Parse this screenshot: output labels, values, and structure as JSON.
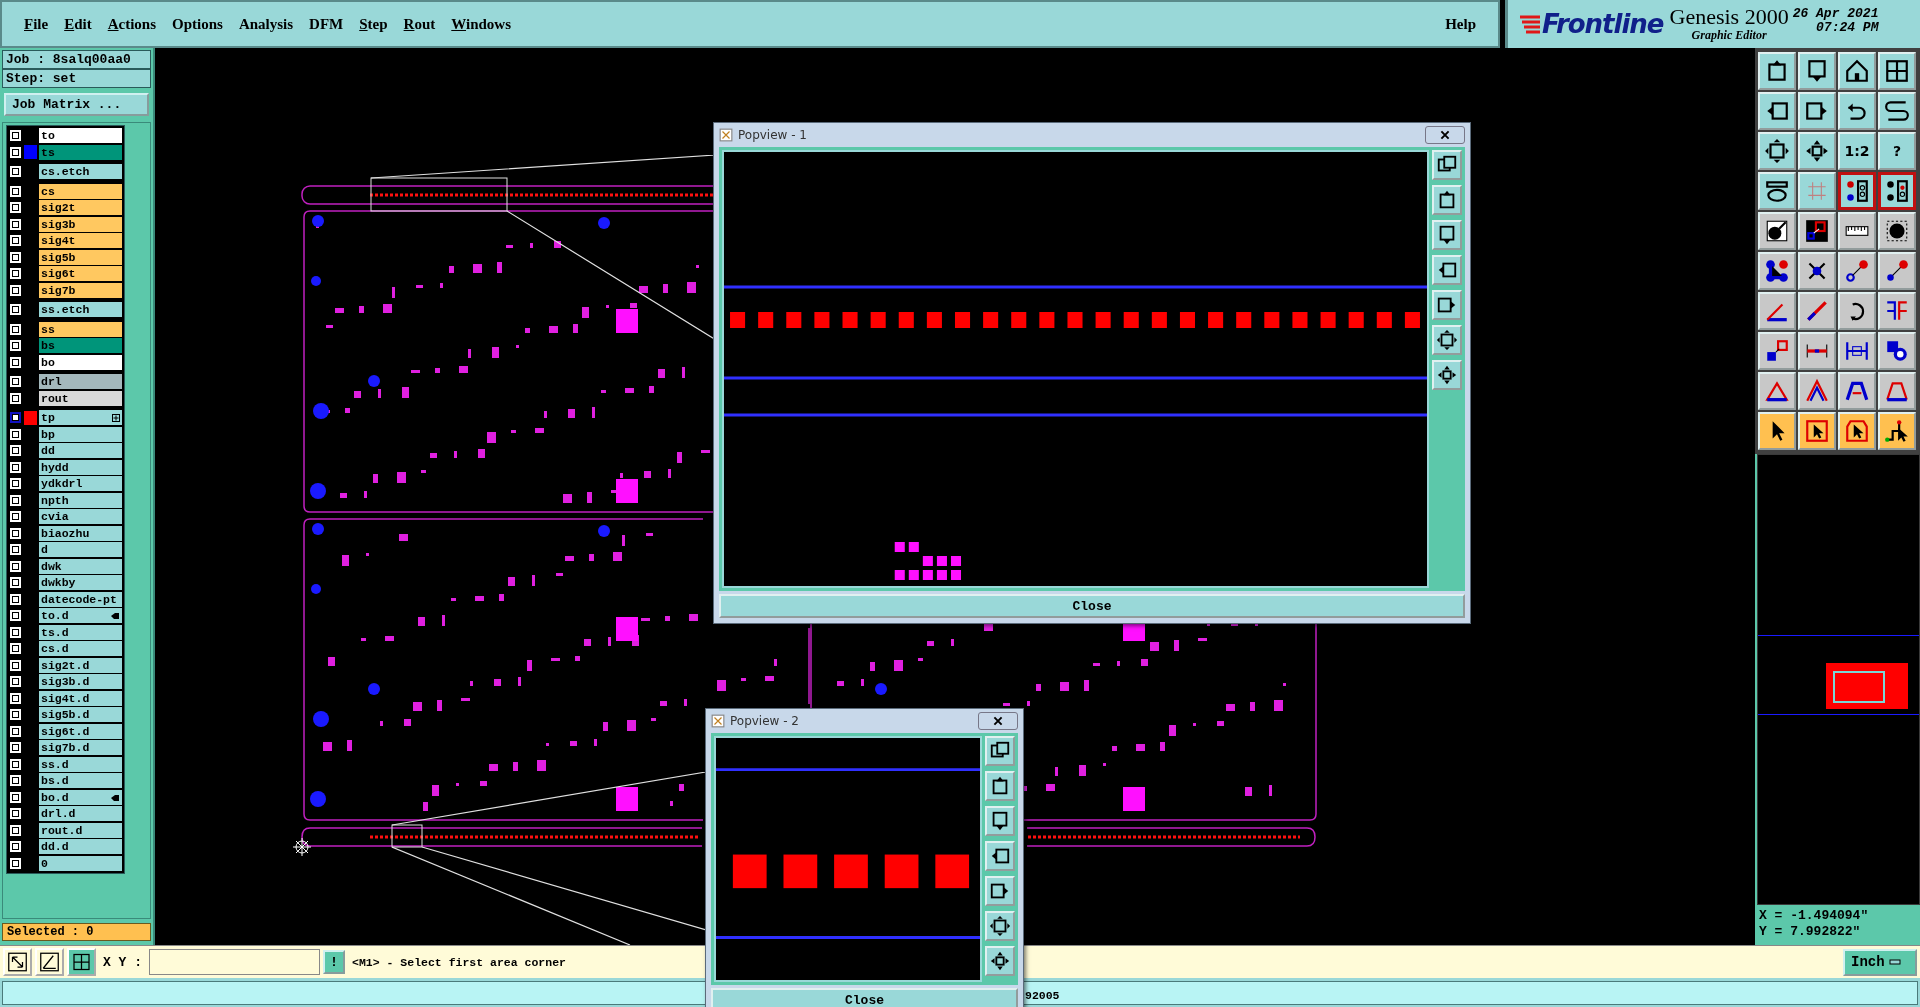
{
  "menu": [
    {
      "label": "File",
      "underlined": true
    },
    {
      "label": "Edit",
      "underlined": true
    },
    {
      "label": "Actions",
      "underlined": true
    },
    {
      "label": "Options",
      "underlined": false
    },
    {
      "label": "Analysis",
      "underlined": false
    },
    {
      "label": "DFM",
      "underlined": false
    },
    {
      "label": "Step",
      "underlined": true
    },
    {
      "label": "Rout",
      "underlined": true
    },
    {
      "label": "Windows",
      "underlined": true
    }
  ],
  "help": "Help",
  "brand": {
    "logo": "Frontline",
    "product": "Genesis 2000",
    "subtitle": "Graphic Editor",
    "date": "26 Apr 2021",
    "time": "07:24 PM"
  },
  "job": {
    "job": "Job : 8salq00aa0",
    "step": "Step: set",
    "matrix_button": "Job Matrix ..."
  },
  "layer_groups": [
    {
      "layers": [
        {
          "name": "to",
          "color": "#ffffff",
          "selected": false,
          "linked": false
        },
        {
          "name": "ts",
          "color": "#00957a",
          "swatch": {
            "color": "#0000ff"
          },
          "selected": false,
          "linked": false
        }
      ]
    },
    {
      "layers": [
        {
          "name": "cs.etch",
          "color": "#99d8d8",
          "selected": false,
          "linked": false
        }
      ]
    },
    {
      "layers": [
        {
          "name": "cs",
          "color": "#ffc860",
          "selected": false,
          "linked": false
        },
        {
          "name": "sig2t",
          "color": "#ffc860",
          "selected": false,
          "linked": false
        },
        {
          "name": "sig3b",
          "color": "#ffc860",
          "selected": false,
          "linked": false
        },
        {
          "name": "sig4t",
          "color": "#ffc860",
          "selected": false,
          "linked": false
        },
        {
          "name": "sig5b",
          "color": "#ffc860",
          "selected": false,
          "linked": false
        },
        {
          "name": "sig6t",
          "color": "#ffc860",
          "selected": false,
          "linked": false
        },
        {
          "name": "sig7b",
          "color": "#ffc860",
          "selected": false,
          "linked": false
        }
      ]
    },
    {
      "layers": [
        {
          "name": "ss.etch",
          "color": "#99d8d8",
          "selected": false,
          "linked": false
        }
      ]
    },
    {
      "layers": [
        {
          "name": "ss",
          "color": "#ffc860",
          "selected": false,
          "linked": false
        },
        {
          "name": "bs",
          "color": "#00957a",
          "selected": false,
          "linked": false
        },
        {
          "name": "bo",
          "color": "#ffffff",
          "selected": false,
          "linked": false
        }
      ]
    },
    {
      "layers": [
        {
          "name": "drl",
          "color": "#a4b8bc",
          "selected": false,
          "linked": false
        },
        {
          "name": "rout",
          "color": "#d8d8d8",
          "selected": false,
          "linked": false
        }
      ]
    },
    {
      "layers": [
        {
          "name": "tp",
          "color": "#99d8d8",
          "swatch": {
            "color": "#ff0000"
          },
          "selected": true,
          "linked": false
        },
        {
          "name": "bp",
          "color": "#99d8d8",
          "selected": false,
          "linked": false
        },
        {
          "name": "dd",
          "color": "#99d8d8",
          "selected": false,
          "linked": false
        },
        {
          "name": "hydd",
          "color": "#99d8d8",
          "selected": false,
          "linked": false
        },
        {
          "name": "ydkdrl",
          "color": "#99d8d8",
          "selected": false,
          "linked": false
        },
        {
          "name": "npth",
          "color": "#99d8d8",
          "selected": false,
          "linked": false
        },
        {
          "name": "cvia",
          "color": "#99d8d8",
          "selected": false,
          "linked": false
        },
        {
          "name": "biaozhu",
          "color": "#99d8d8",
          "selected": false,
          "linked": false
        },
        {
          "name": "d",
          "color": "#99d8d8",
          "selected": false,
          "linked": false
        },
        {
          "name": "dwk",
          "color": "#99d8d8",
          "selected": false,
          "linked": false
        },
        {
          "name": "dwkby",
          "color": "#99d8d8",
          "selected": false,
          "linked": false
        },
        {
          "name": "datecode-pt",
          "color": "#99d8d8",
          "selected": false,
          "linked": false
        },
        {
          "name": "to.d",
          "color": "#99d8d8",
          "selected": false,
          "linked": true
        },
        {
          "name": "ts.d",
          "color": "#99d8d8",
          "selected": false,
          "linked": false
        },
        {
          "name": "cs.d",
          "color": "#99d8d8",
          "selected": false,
          "linked": false
        },
        {
          "name": "sig2t.d",
          "color": "#99d8d8",
          "selected": false,
          "linked": false
        },
        {
          "name": "sig3b.d",
          "color": "#99d8d8",
          "selected": false,
          "linked": false
        },
        {
          "name": "sig4t.d",
          "color": "#99d8d8",
          "selected": false,
          "linked": false
        },
        {
          "name": "sig5b.d",
          "color": "#99d8d8",
          "selected": false,
          "linked": false
        },
        {
          "name": "sig6t.d",
          "color": "#99d8d8",
          "selected": false,
          "linked": false
        },
        {
          "name": "sig7b.d",
          "color": "#99d8d8",
          "selected": false,
          "linked": false
        },
        {
          "name": "ss.d",
          "color": "#99d8d8",
          "selected": false,
          "linked": false
        },
        {
          "name": "bs.d",
          "color": "#99d8d8",
          "selected": false,
          "linked": false
        },
        {
          "name": "bo.d",
          "color": "#99d8d8",
          "selected": false,
          "linked": true
        },
        {
          "name": "drl.d",
          "color": "#99d8d8",
          "selected": false,
          "linked": false
        },
        {
          "name": "rout.d",
          "color": "#99d8d8",
          "selected": false,
          "linked": false
        },
        {
          "name": "dd.d",
          "color": "#99d8d8",
          "selected": false,
          "linked": false
        },
        {
          "name": "0",
          "color": "#99d8d8",
          "selected": false,
          "linked": false
        }
      ]
    }
  ],
  "selected_count": "Selected : 0",
  "tool_rows": [
    {
      "kind": "view",
      "buttons": [
        {
          "on": false
        },
        {
          "on": false
        },
        {
          "on": false
        },
        {
          "on": false
        }
      ]
    },
    {
      "kind": "view",
      "buttons": [
        {
          "on": false
        },
        {
          "on": false
        },
        {
          "on": false
        },
        {
          "on": false
        }
      ]
    },
    {
      "kind": "view",
      "buttons": [
        {
          "on": false
        },
        {
          "on": false
        },
        {
          "on": false,
          "label": "1:2"
        },
        {
          "on": false,
          "label": "?"
        }
      ]
    },
    {
      "kind": "view",
      "buttons": [
        {
          "on": false
        },
        {
          "on": false
        },
        {
          "on": true
        },
        {
          "on": true
        }
      ]
    },
    {
      "kind": "edit",
      "buttons": [
        {
          "on": false
        },
        {
          "on": false
        },
        {
          "on": false
        },
        {
          "on": false
        }
      ]
    },
    {
      "kind": "edit",
      "buttons": [
        {
          "on": false
        },
        {
          "on": false
        },
        {
          "on": false
        },
        {
          "on": false
        }
      ]
    },
    {
      "kind": "edit",
      "buttons": [
        {
          "on": false
        },
        {
          "on": false
        },
        {
          "on": false
        },
        {
          "on": false
        }
      ]
    },
    {
      "kind": "edit",
      "buttons": [
        {
          "on": false
        },
        {
          "on": false
        },
        {
          "on": false
        },
        {
          "on": false
        }
      ]
    },
    {
      "kind": "edit",
      "buttons": [
        {
          "on": false
        },
        {
          "on": false
        },
        {
          "on": false
        },
        {
          "on": false
        }
      ]
    },
    {
      "kind": "select",
      "buttons": [
        {
          "on": false
        },
        {
          "on": false
        },
        {
          "on": false
        },
        {
          "on": false
        }
      ]
    }
  ],
  "coordinates": {
    "x": "X = -1.494094\"",
    "y": "Y = 7.992822\""
  },
  "command": {
    "xy_label": "X Y :",
    "bang": "!",
    "prompt": "<M1> - Select first area corner",
    "units": "Inch"
  },
  "status_text": "92005",
  "popviews": [
    {
      "title": "Popview - 1",
      "close": "Close"
    },
    {
      "title": "Popview - 2",
      "close": "Close"
    }
  ]
}
